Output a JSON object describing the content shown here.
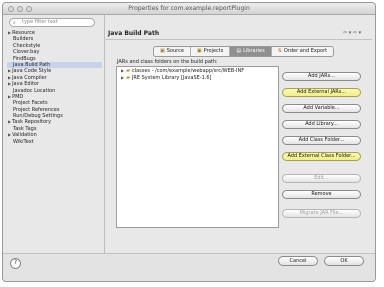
{
  "window": {
    "title": "Properties for com.example.reportPlugin"
  },
  "filter": {
    "placeholder": "type filter text"
  },
  "sidebar": {
    "items": [
      {
        "label": "Resource",
        "expandable": true,
        "child": false,
        "selected": false
      },
      {
        "label": "Builders",
        "expandable": false,
        "child": true,
        "selected": false
      },
      {
        "label": "Checkstyle",
        "expandable": false,
        "child": true,
        "selected": false
      },
      {
        "label": "Clover.bay",
        "expandable": false,
        "child": true,
        "selected": false
      },
      {
        "label": "FindBugs",
        "expandable": false,
        "child": true,
        "selected": false
      },
      {
        "label": "Java Build Path",
        "expandable": false,
        "child": true,
        "selected": true
      },
      {
        "label": "Java Code Style",
        "expandable": true,
        "child": false,
        "selected": false
      },
      {
        "label": "Java Compiler",
        "expandable": true,
        "child": false,
        "selected": false
      },
      {
        "label": "Java Editor",
        "expandable": true,
        "child": false,
        "selected": false
      },
      {
        "label": "Javadoc Location",
        "expandable": false,
        "child": true,
        "selected": false
      },
      {
        "label": "PMD",
        "expandable": true,
        "child": false,
        "selected": false
      },
      {
        "label": "Project Facets",
        "expandable": false,
        "child": true,
        "selected": false
      },
      {
        "label": "Project References",
        "expandable": false,
        "child": true,
        "selected": false
      },
      {
        "label": "Run/Debug Settings",
        "expandable": false,
        "child": true,
        "selected": false
      },
      {
        "label": "Task Repository",
        "expandable": true,
        "child": false,
        "selected": false
      },
      {
        "label": "Task Tags",
        "expandable": false,
        "child": true,
        "selected": false
      },
      {
        "label": "Validation",
        "expandable": true,
        "child": false,
        "selected": false
      },
      {
        "label": "WikiText",
        "expandable": false,
        "child": true,
        "selected": false
      }
    ]
  },
  "pane": {
    "title": "Java Build Path",
    "nav_icons": "⇦ ▾ ⇨ ▾"
  },
  "tabs": [
    {
      "label": "Source",
      "icon": "▣",
      "active": false
    },
    {
      "label": "Projects",
      "icon": "▣",
      "active": false
    },
    {
      "label": "Libraries",
      "icon": "▤",
      "active": true
    },
    {
      "label": "Order and Export",
      "icon": "⇅",
      "active": false
    }
  ],
  "libraries": {
    "caption": "JARs and class folders on the build path:",
    "entries": [
      {
        "label": "classes - /com/example/webapp/src/WEB-INF",
        "icon": "▰"
      },
      {
        "label": "JRE System Library [JavaSE-1.6]",
        "icon": "▰"
      }
    ]
  },
  "buttons": [
    {
      "label": "Add JARs...",
      "highlighted": false,
      "enabled": true
    },
    {
      "label": "Add External JARs...",
      "highlighted": true,
      "enabled": true
    },
    {
      "label": "Add Variable...",
      "highlighted": false,
      "enabled": true
    },
    {
      "label": "Add Library...",
      "highlighted": false,
      "enabled": true
    },
    {
      "label": "Add Class Folder...",
      "highlighted": false,
      "enabled": true
    },
    {
      "label": "Add External Class Folder...",
      "highlighted": true,
      "enabled": true
    },
    {
      "label": "Edit...",
      "highlighted": false,
      "enabled": false
    },
    {
      "label": "Remove",
      "highlighted": false,
      "enabled": true
    },
    {
      "label": "Migrate JAR File...",
      "highlighted": false,
      "enabled": false
    }
  ],
  "footer": {
    "help_label": "?",
    "cancel_label": "Cancel",
    "ok_label": "OK"
  },
  "colors": {
    "highlight": "#f2f29a",
    "selection": "#c5d4eb"
  }
}
